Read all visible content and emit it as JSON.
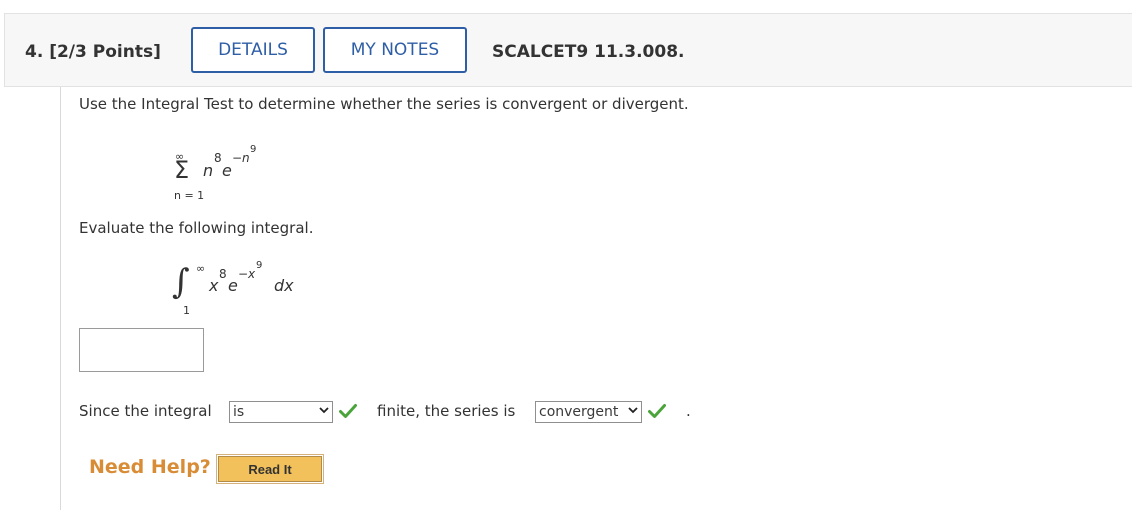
{
  "header": {
    "question_label": "4.  [2/3 Points]",
    "details_button": "DETAILS",
    "notes_button": "MY NOTES",
    "source_code": "SCALCET9 11.3.008."
  },
  "question": {
    "prompt": "Use the Integral Test to determine whether the series is convergent or divergent.",
    "series": {
      "sum_symbol": "Σ",
      "upper": "∞",
      "lower": "n = 1",
      "base": "n",
      "base_exp": "8",
      "e": "e",
      "e_exp": "−n",
      "e_exp_exp": "9"
    },
    "evaluate_prompt": "Evaluate the following integral.",
    "integral": {
      "symbol": "∫",
      "upper": "∞",
      "lower": "1",
      "base": "x",
      "base_exp": "8",
      "e": "e",
      "e_exp": "−x",
      "e_exp_exp": "9",
      "differential": "dx"
    },
    "answer_value": "",
    "since_prefix": "Since the integral",
    "since_select_value": "is",
    "finite_text": "finite, the series is",
    "series_select_value": "convergent",
    "period": "."
  },
  "help": {
    "need_help": "Need Help?",
    "read_it": "Read It"
  },
  "colors": {
    "accent_blue": "#2e5ea6",
    "check_green": "#4aa43a",
    "help_orange": "#d98c36",
    "read_it_fill": "#f2c15c"
  },
  "icons": {
    "correct": "checkmark-icon",
    "dropdown": "chevron-down-icon"
  }
}
